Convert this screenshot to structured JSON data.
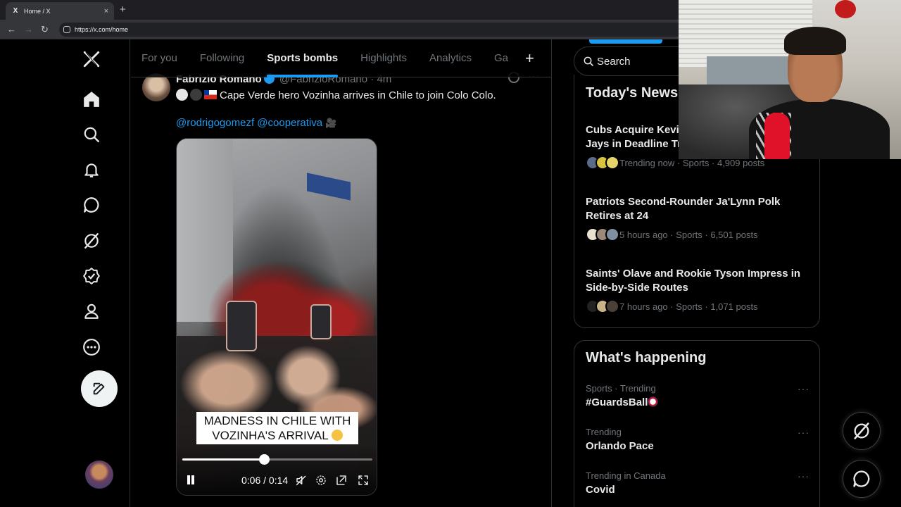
{
  "browser": {
    "tab_title": "Home / X",
    "tab_favicon": "X",
    "tab_close": "×",
    "new_tab": "+",
    "url": "https://x.com/home"
  },
  "leftnav": {
    "logo": "X",
    "items": [
      "home-icon",
      "search-icon",
      "notifications-icon",
      "messages-icon",
      "grok-icon",
      "verified-icon",
      "profile-icon",
      "more-icon"
    ],
    "compose_icon": "compose-icon"
  },
  "feed_tabs": {
    "tabs": [
      "For you",
      "Following",
      "Sports bombs",
      "Highlights",
      "Analytics",
      "Ga"
    ],
    "active_index": 2,
    "add": "+"
  },
  "tweet": {
    "name": "Fabrizio Romano",
    "handle": "@FabrizioRomano",
    "time": "· 4m",
    "more": "···",
    "text": "Cape Verde hero Vozinha arrives in Chile to join Colo Colo.",
    "mentions": "@rodrigogomezf @cooperativa",
    "mentions_suffix": "🎥",
    "video": {
      "caption_line1": "MADNESS IN CHILE WITH",
      "caption_line2": "VOZINHA'S ARRIVAL",
      "time": "0:06 / 0:14",
      "progress": 0.43
    }
  },
  "right": {
    "search_placeholder": "Search",
    "news_title": "Today's News",
    "news": [
      {
        "headline": "Cubs Acquire Kevi… Jays in Deadline Tr…",
        "line1": "Cubs Acquire Kevi",
        "line2": "Jays in Deadline Tr",
        "meta": "Trending now · Sports · 4,909 posts"
      },
      {
        "headline": "Patriots Second-Rounder Ja'Lynn Polk Retires at 24",
        "line1": "Patriots Second-Rounder Ja'Lynn Polk",
        "line2": "Retires at 24",
        "meta": "5 hours ago · Sports · 6,501 posts"
      },
      {
        "headline": "Saints' Olave and Rookie Tyson Impress in Side-by-Side Routes",
        "line1": "Saints' Olave and Rookie Tyson Impress in",
        "line2": "Side-by-Side Routes",
        "meta": "7 hours ago · Sports · 1,071 posts"
      }
    ],
    "happening_title": "What's happening",
    "trends": [
      {
        "context": "Sports · Trending",
        "name": "#GuardsBall"
      },
      {
        "context": "Trending",
        "name": "Orlando Pace"
      },
      {
        "context": "Trending in Canada",
        "name": "Covid"
      }
    ],
    "trend_more": "···"
  },
  "colors": {
    "accent": "#1d9bf0",
    "bg": "#000000",
    "text": "#e7e9ea",
    "muted": "#71767b",
    "border": "#2f3336"
  }
}
